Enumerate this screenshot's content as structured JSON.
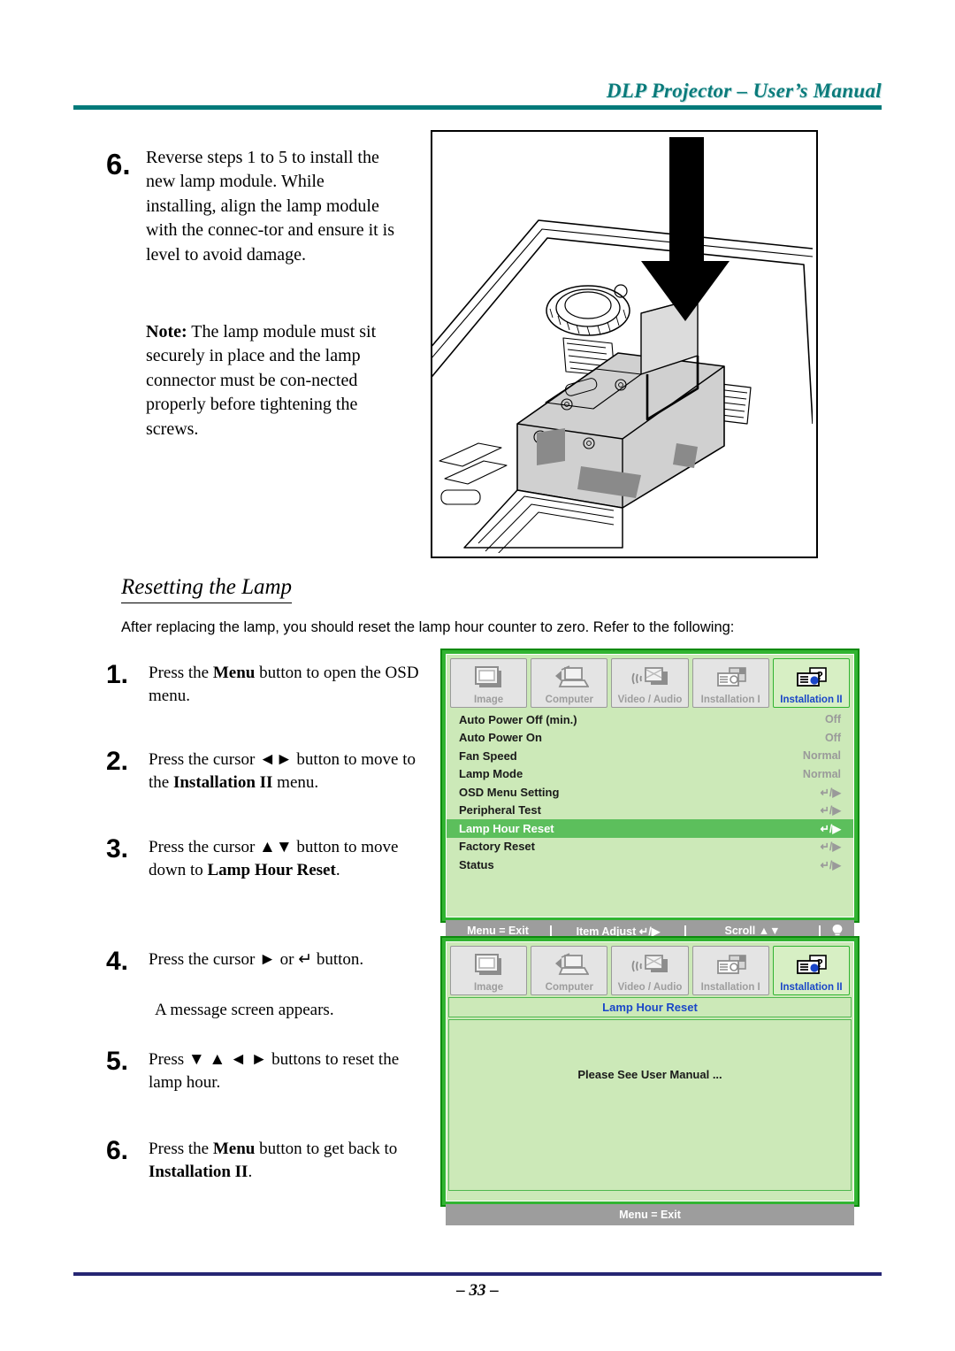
{
  "header": {
    "title": "DLP Projector – User’s Manual",
    "rule_color": "#007a7a"
  },
  "step6": {
    "number": "6.",
    "body": "Reverse steps 1 to 5 to install the new lamp module. While installing, align the lamp module with the connec-tor and ensure it is level to avoid damage.",
    "note_label": "Note:",
    "note_body": " The lamp module must sit securely in place and the lamp connector must be con-nected properly before tightening the screws."
  },
  "illustration": {
    "caption": "projector-lamp-module-installation-diagram"
  },
  "section": {
    "heading": "Resetting the Lamp",
    "intro": "After replacing the lamp, you should reset the lamp hour counter to zero. Refer to the following:"
  },
  "steps": [
    {
      "n": "1.",
      "pre": "Press the ",
      "b1": "Menu",
      "mid": " button to open the OSD menu.",
      "b2": "",
      "post": ""
    },
    {
      "n": "2.",
      "pre": "Press the cursor ◄► button to move to the ",
      "b1": "Installation II",
      "mid": " menu.",
      "b2": "",
      "post": ""
    },
    {
      "n": "3.",
      "pre": "Press the cursor ▲▼ button to move down to ",
      "b1": "Lamp Hour Reset",
      "mid": ".",
      "b2": "",
      "post": ""
    },
    {
      "n": "4.",
      "pre": "Press the cursor ► or ↵ button.",
      "b1": "",
      "mid": "",
      "b2": "",
      "post": ""
    },
    {
      "n": "5.",
      "pre": "Press ▼ ▲ ◄ ► buttons to reset the lamp hour.",
      "b1": "",
      "mid": "",
      "b2": "",
      "post": ""
    },
    {
      "n": "6.",
      "pre": "Press the ",
      "b1": "Menu",
      "mid": " button to get back to ",
      "b2": "Installation II",
      "post": "."
    }
  ],
  "step4_note": "A message screen appears.",
  "osd_tabs": [
    {
      "label": "Image",
      "icon": "screen-icon",
      "active": false
    },
    {
      "label": "Computer",
      "icon": "laptop-icon",
      "active": false
    },
    {
      "label": "Video / Audio",
      "icon": "video-audio-icon",
      "active": false
    },
    {
      "label": "Installation I",
      "icon": "installation-1-icon",
      "active": false
    },
    {
      "label": "Installation II",
      "icon": "installation-2-icon",
      "active": true
    }
  ],
  "osd_menu": {
    "rows": [
      {
        "label": "Auto Power Off (min.)",
        "value": "Off",
        "selected": false
      },
      {
        "label": "Auto Power On",
        "value": "Off",
        "selected": false
      },
      {
        "label": "Fan Speed",
        "value": "Normal",
        "selected": false
      },
      {
        "label": "Lamp Mode",
        "value": "Normal",
        "selected": false
      },
      {
        "label": "OSD Menu Setting",
        "value": "↵/▶",
        "selected": false
      },
      {
        "label": "Peripheral Test",
        "value": "↵/▶",
        "selected": false
      },
      {
        "label": "Lamp Hour Reset",
        "value": "↵/▶",
        "selected": true
      },
      {
        "label": "Factory Reset",
        "value": "↵/▶",
        "selected": false
      },
      {
        "label": "Status",
        "value": "↵/▶",
        "selected": false
      }
    ],
    "statusbar": {
      "exit": "Menu = Exit",
      "adjust": "Item Adjust ↵/▶",
      "scroll": "Scroll ▲▼",
      "lamp_icon": "lamp-icon"
    }
  },
  "osd_message": {
    "title": "Lamp Hour Reset",
    "message": "Please See User Manual ...",
    "statusbar": {
      "exit": "Menu = Exit"
    }
  },
  "footer": {
    "page_number": "– 33 –",
    "rule_color": "#262673"
  },
  "colors": {
    "teal": "#007a7a",
    "osd_border_green": "#31b431",
    "osd_panel_green": "#cce9b8",
    "osd_highlight_green": "#5cbf5c",
    "osd_bar_gray": "#9d9d9d",
    "osd_active_label_blue": "#1a46c8",
    "footer_navy": "#262673"
  }
}
